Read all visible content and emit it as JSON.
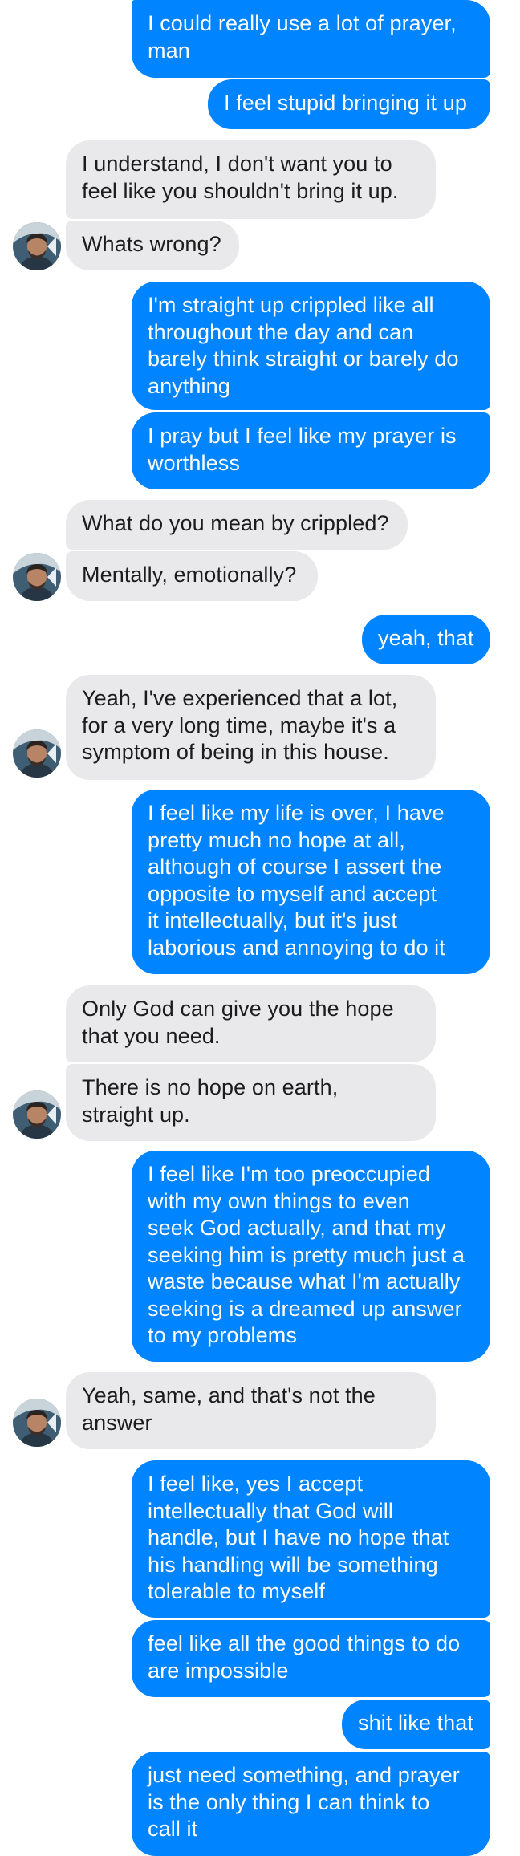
{
  "colors": {
    "outgoing_bubble": "#0084ff",
    "incoming_bubble": "#e9e9eb",
    "outgoing_text": "#ffffff",
    "incoming_text": "#1c1c1c"
  },
  "messages": [
    {
      "from": "me",
      "text": "I could really use a lot of prayer,\nman"
    },
    {
      "from": "me",
      "text": "I feel stupid bringing it up"
    },
    {
      "from": "them",
      "text": "I understand, I don't want you to\nfeel like you shouldn't bring it up."
    },
    {
      "from": "them",
      "text": "Whats wrong?"
    },
    {
      "from": "me",
      "text": "I'm straight up crippled like all\nthroughout the day and can\nbarely think straight or barely do\nanything"
    },
    {
      "from": "me",
      "text": "I pray but I feel like my prayer is\nworthless"
    },
    {
      "from": "them",
      "text": "What do you mean by crippled?"
    },
    {
      "from": "them",
      "text": "Mentally, emotionally?"
    },
    {
      "from": "me",
      "text": "yeah, that"
    },
    {
      "from": "them",
      "text": "Yeah, I've experienced that a lot,\nfor a very long time, maybe it's a\nsymptom of being in this house."
    },
    {
      "from": "me",
      "text": "I feel like my life is over, I have\npretty much no hope at all,\nalthough of course I assert the\nopposite to myself and accept\nit intellectually, but it's just\nlaborious and annoying to do it"
    },
    {
      "from": "them",
      "text": "Only God can give you the hope\nthat you need."
    },
    {
      "from": "them",
      "text": "There is no hope on earth,\nstraight up."
    },
    {
      "from": "me",
      "text": "I feel like I'm too preoccupied\nwith my own things to even\nseek God actually, and that my\nseeking him is pretty much just a\nwaste because what I'm actually\nseeking is a dreamed up answer\nto my problems"
    },
    {
      "from": "them",
      "text": "Yeah, same, and that's not the\nanswer"
    },
    {
      "from": "me",
      "text": "I feel like, yes I accept\nintellectually that God will\nhandle, but I have no hope that\nhis handling will be something\ntolerable to myself"
    },
    {
      "from": "me",
      "text": "feel like all the good things to do\nare impossible"
    },
    {
      "from": "me",
      "text": "shit like that"
    },
    {
      "from": "me",
      "text": "just need something, and prayer\nis the only thing I can think to\ncall it"
    }
  ],
  "avatar_icon": "contact-avatar-photo"
}
